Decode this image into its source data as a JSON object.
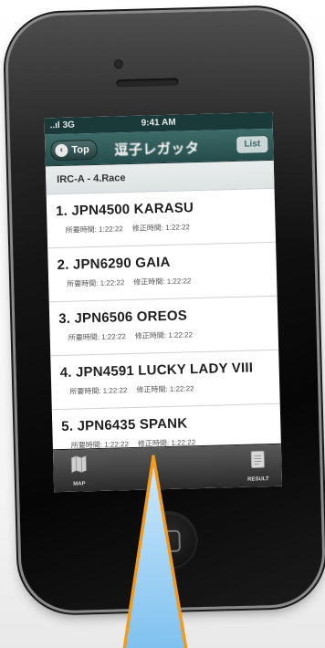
{
  "statusbar": {
    "signal": "..ıl 3G",
    "time": "9:41 AM"
  },
  "navbar": {
    "back_label": "Top",
    "title": "逗子レガッタ",
    "right_label": "List"
  },
  "section_header": "IRC-A - 4.Race",
  "results": [
    {
      "name": "1. JPN4500 KARASU",
      "time1": "所要時間: 1:22:22",
      "time2": "修正時間: 1:22:22"
    },
    {
      "name": "2. JPN6290 GAIA",
      "time1": "所要時間: 1:22:22",
      "time2": "修正時間: 1:22:22"
    },
    {
      "name": "3. JPN6506 OREOS",
      "time1": "所要時間: 1:22:22",
      "time2": "修正時間: 1:22:22"
    },
    {
      "name": "4. JPN4591 LUCKY LADY VIII",
      "time1": "所要時間: 1:22:22",
      "time2": "修正時間: 1:22:22"
    },
    {
      "name": "5. JPN6435 SPANK",
      "time1": "所要時間: 1:22:22",
      "time2": "修正時間: 1:22:22"
    }
  ],
  "tabbar": {
    "map_label": "MAP",
    "result_label": "RESULT"
  },
  "colors": {
    "navbar": "#2f5a58",
    "arrow_fill": "#7fc1ef",
    "arrow_stroke": "#f39a1c"
  }
}
